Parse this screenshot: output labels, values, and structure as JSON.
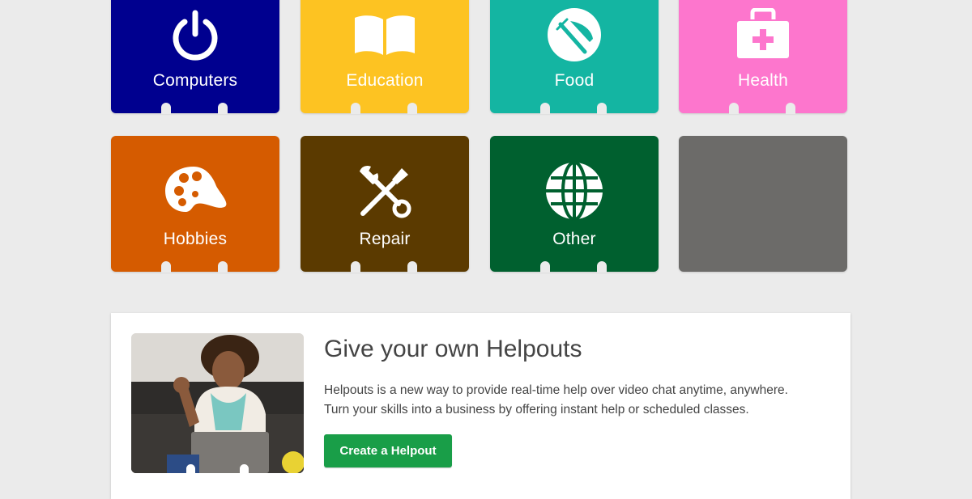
{
  "categories": [
    {
      "label": "Computers",
      "icon": "power-icon",
      "color": "#00008f"
    },
    {
      "label": "Education",
      "icon": "book-icon",
      "color": "#fdc322"
    },
    {
      "label": "Food",
      "icon": "fork-knife-icon",
      "color": "#14b5a2"
    },
    {
      "label": "Health",
      "icon": "first-aid-kit-icon",
      "color": "#fd76cd"
    },
    {
      "label": "Hobbies",
      "icon": "paint-palette-icon",
      "color": "#d55b00"
    },
    {
      "label": "Repair",
      "icon": "wrench-screwdriver-icon",
      "color": "#5b3a00"
    },
    {
      "label": "Other",
      "icon": "globe-icon",
      "color": "#00602f"
    },
    {
      "label": "",
      "icon": "",
      "color": "#6c6b69"
    }
  ],
  "promo": {
    "title": "Give your own Helpouts",
    "description_line1": "Helpouts is a new way to provide real-time help over video chat anytime, anywhere.",
    "description_line2": "Turn your skills into a business by offering instant help or scheduled classes.",
    "button_label": "Create a Helpout",
    "button_color": "#199e48"
  }
}
